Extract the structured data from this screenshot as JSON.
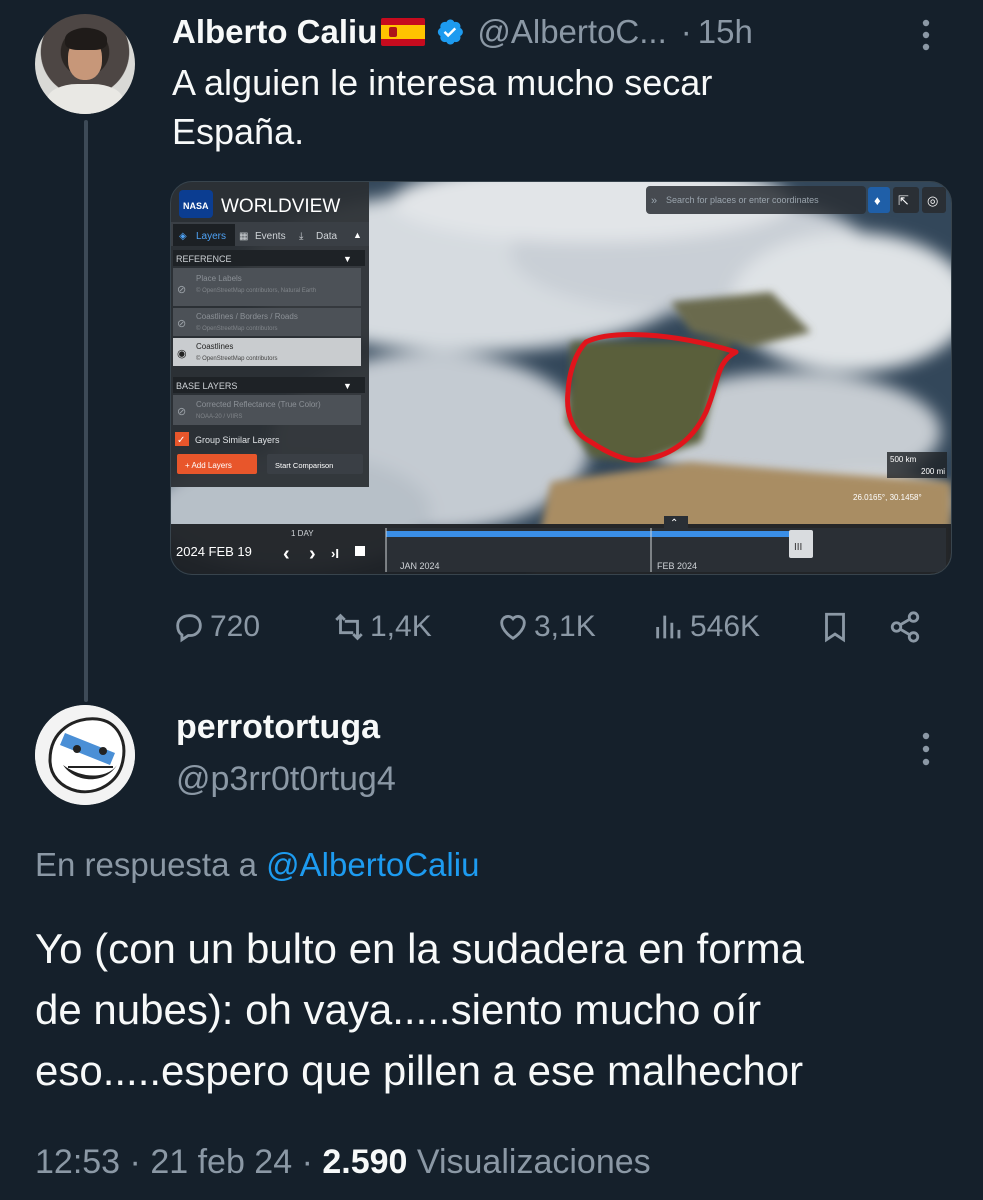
{
  "tweet": {
    "author_name": "Alberto Caliu",
    "flag": "🇪🇸",
    "handle": "@AlbertoC...",
    "separator": "·",
    "time": "15h",
    "text_line1": "A alguien le interesa mucho secar",
    "text_line2": "España.",
    "map": {
      "app_title": "WORLDVIEW",
      "nasa_badge": "NASA",
      "tabs": [
        "Layers",
        "Events",
        "Data"
      ],
      "reference_heading": "REFERENCE",
      "reference_layers": [
        {
          "name": "Place Labels",
          "source": "© OpenStreetMap contributors, Natural Earth"
        },
        {
          "name": "Coastlines / Borders / Roads",
          "source": "© OpenStreetMap contributors"
        },
        {
          "name": "Coastlines",
          "source": "© OpenStreetMap contributors"
        }
      ],
      "base_heading": "BASE LAYERS",
      "base_layers": [
        {
          "name": "Corrected Reflectance (True Color)",
          "source": "NOAA-20 / VIIRS"
        }
      ],
      "group_similar": "Group Similar Layers",
      "add_layers": "+ Add Layers",
      "start_comparison": "Start Comparison",
      "search_placeholder": "Search for places or enter coordinates",
      "scale_km": "500 km",
      "scale_mi": "200 mi",
      "coordinates": "26.0165°, 30.1458°",
      "timeline_interval": "1 DAY",
      "date": "2024 FEB 19",
      "month_labels": [
        "JAN 2024",
        "FEB 2024"
      ]
    },
    "stats": {
      "replies": "720",
      "retweets": "1,4K",
      "likes": "3,1K",
      "views": "546K"
    }
  },
  "reply": {
    "author_name": "perrotortuga",
    "handle": "@p3rr0t0rtug4",
    "reply_prefix": "En respuesta a",
    "reply_to": "@AlbertoCaliu",
    "line1": "Yo (con un bulto en la sudadera en forma",
    "line2": "de nubes): oh vaya.....siento mucho oír",
    "line3": "eso.....espero que pillen a ese malhechor",
    "time": "12:53",
    "sep": "·",
    "date": "21 feb 24",
    "views_count": "2.590",
    "views_label": "Visualizaciones"
  },
  "colors": {
    "background": "#15202b",
    "text": "#f7f9f9",
    "secondary": "#8b98a5",
    "accent": "#1d9bf0",
    "marker": "#e0141b"
  }
}
